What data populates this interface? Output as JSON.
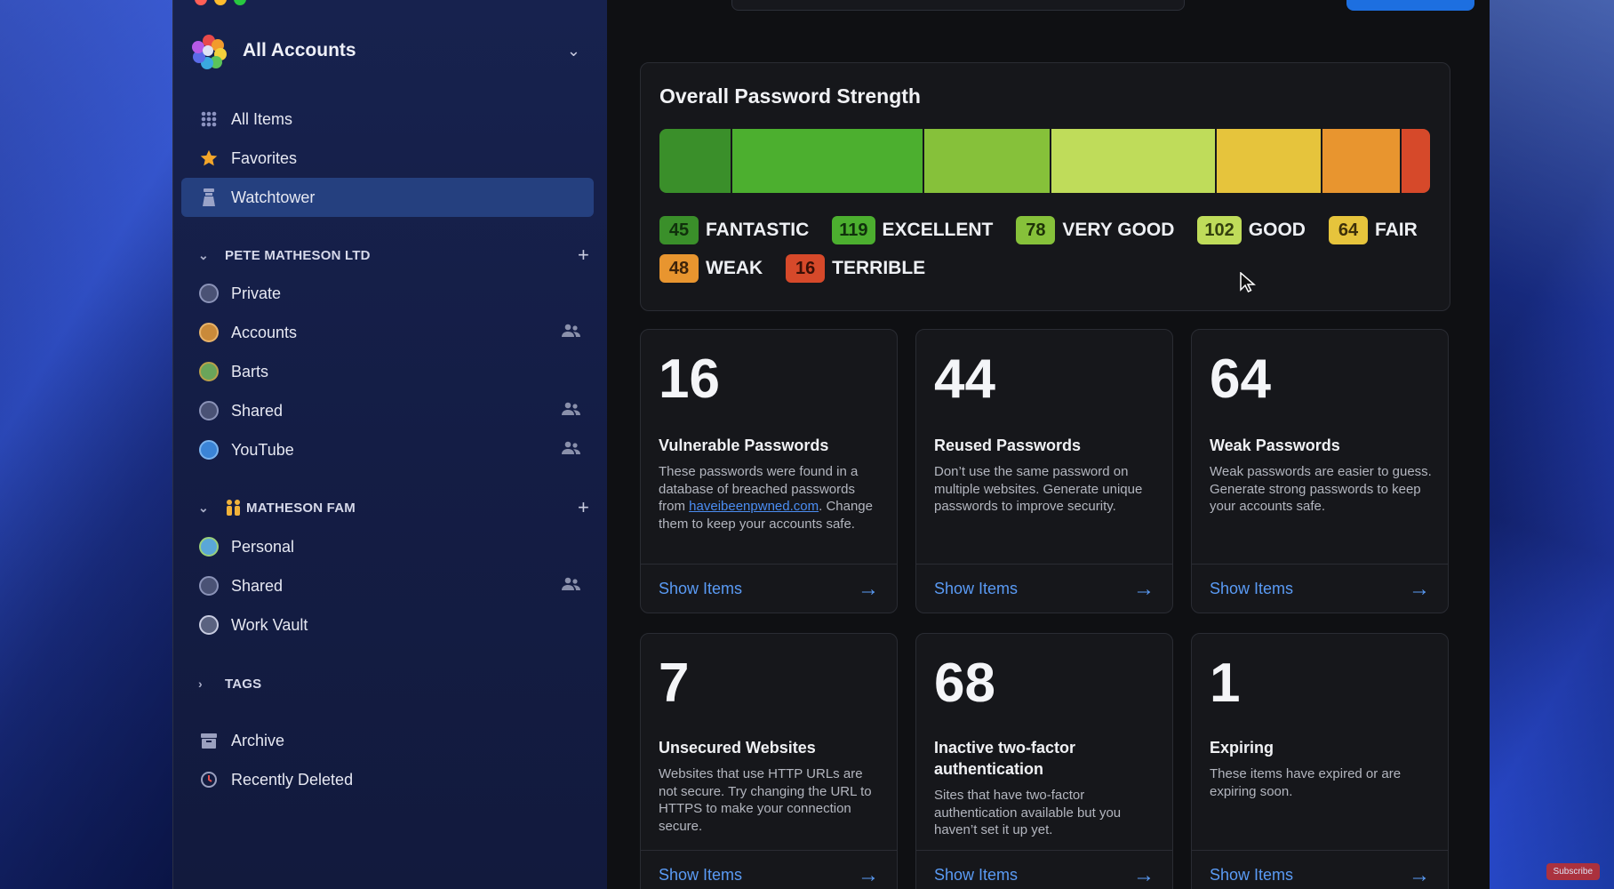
{
  "sidebar": {
    "account": {
      "name": "All Accounts"
    },
    "top_items": [
      {
        "label": "All Items",
        "icon": "grid-icon"
      },
      {
        "label": "Favorites",
        "icon": "star-icon"
      },
      {
        "label": "Watchtower",
        "icon": "watchtower-icon",
        "active": true
      }
    ],
    "sections": [
      {
        "title": "PETE MATHESON LTD",
        "items": [
          {
            "label": "Private",
            "shared": false
          },
          {
            "label": "Accounts",
            "shared": true
          },
          {
            "label": "Barts",
            "shared": false
          },
          {
            "label": "Shared",
            "shared": true
          },
          {
            "label": "YouTube",
            "shared": true
          }
        ]
      },
      {
        "title": "MATHESON FAM",
        "items": [
          {
            "label": "Personal",
            "shared": false
          },
          {
            "label": "Shared",
            "shared": true
          },
          {
            "label": "Work Vault",
            "shared": false
          }
        ]
      }
    ],
    "tags_label": "TAGS",
    "bottom_items": [
      {
        "label": "Archive",
        "icon": "archive-icon"
      },
      {
        "label": "Recently Deleted",
        "icon": "trash-restore-icon"
      }
    ]
  },
  "strength": {
    "title": "Overall Password Strength",
    "levels": [
      {
        "count": "45",
        "label": "FANTASTIC",
        "color": "#3a8f2a",
        "badge_text": "#10300c"
      },
      {
        "count": "119",
        "label": "EXCELLENT",
        "color": "#4caf2f",
        "badge_text": "#10300c"
      },
      {
        "count": "78",
        "label": "VERY GOOD",
        "color": "#86c13a",
        "badge_text": "#1e3208"
      },
      {
        "count": "102",
        "label": "GOOD",
        "color": "#bfdc5a",
        "badge_text": "#33400e"
      },
      {
        "count": "64",
        "label": "FAIR",
        "color": "#e6c43c",
        "badge_text": "#3d300a"
      },
      {
        "count": "48",
        "label": "WEAK",
        "color": "#e8952f",
        "badge_text": "#3d230a"
      },
      {
        "count": "16",
        "label": "TERRIBLE",
        "color": "#d6492a",
        "badge_text": "#3a0f06"
      }
    ]
  },
  "cards": [
    {
      "number": "16",
      "title": "Vulnerable Passwords",
      "desc_before": "These passwords were found in a database of breached passwords from ",
      "desc_link": "haveibeenpwned.com",
      "desc_after": ". Change them to keep your accounts safe.",
      "action": "Show Items"
    },
    {
      "number": "44",
      "title": "Reused Passwords",
      "desc_before": "Don’t use the same password on multiple websites. Generate unique passwords to improve security.",
      "desc_link": "",
      "desc_after": "",
      "action": "Show Items"
    },
    {
      "number": "64",
      "title": "Weak Passwords",
      "desc_before": "Weak passwords are easier to guess. Generate strong passwords to keep your accounts safe.",
      "desc_link": "",
      "desc_after": "",
      "action": "Show Items"
    },
    {
      "number": "7",
      "title": "Unsecured Websites",
      "desc_before": "Websites that use HTTP URLs are not secure. Try changing the URL to HTTPS to make your connection secure.",
      "desc_link": "",
      "desc_after": "",
      "action": "Show Items"
    },
    {
      "number": "68",
      "title": "Inactive two-factor authentication",
      "desc_before": "Sites that have two-factor authentication available but you haven’t set it up yet.",
      "desc_link": "",
      "desc_after": "",
      "action": "Show Items"
    },
    {
      "number": "1",
      "title": "Expiring",
      "desc_before": "These items have expired or are expiring soon.",
      "desc_link": "",
      "desc_after": "",
      "action": "Show Items"
    }
  ],
  "overlay": {
    "subscribe": "Subscribe"
  }
}
